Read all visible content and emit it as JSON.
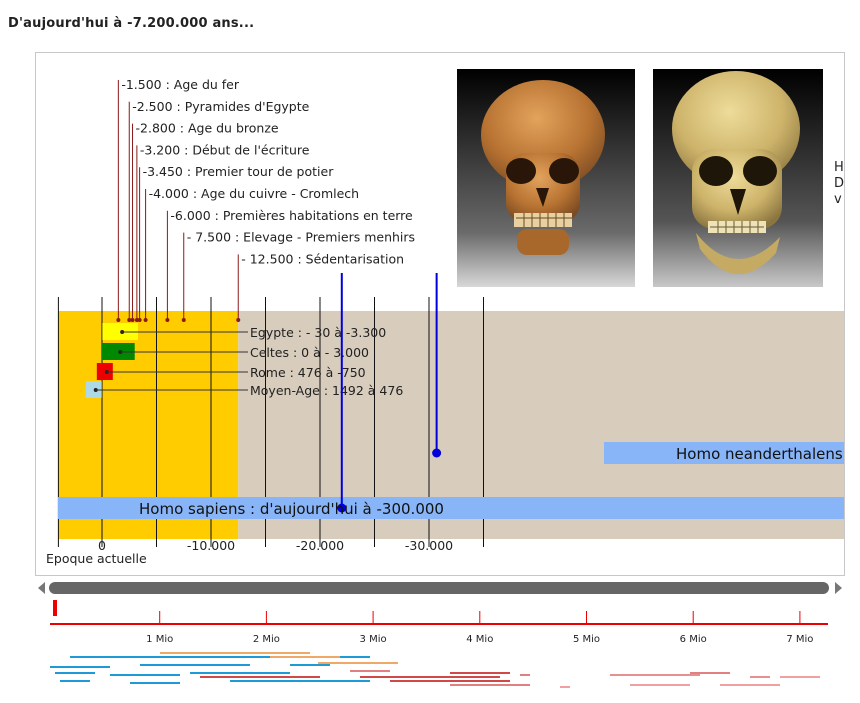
{
  "title": "D'aujourd'hui à -7.200.000 ans...",
  "colors": {
    "recent_zone": "#ffcc00",
    "ancient_zone": "#d8ccbc",
    "span_bar": "#88b4f8",
    "blue_marker": "#0000dd",
    "event_line": "#8b1a1a",
    "egypte": "#ffff00",
    "celtes": "#008800",
    "rome": "#ee0000",
    "moyen_age": "#add8e6",
    "minimap_red": "#ee0000"
  },
  "timeline": {
    "axis_ticks": [
      {
        "value": 0,
        "label": "0"
      },
      {
        "value": -10000,
        "label": "-10.000"
      },
      {
        "value": -20000,
        "label": "-20.000"
      },
      {
        "value": -30000,
        "label": "-30.000"
      }
    ],
    "current_epoch_label": "Epoque actuelle",
    "events": [
      {
        "year": -1500,
        "label": "-1.500 : Age du fer"
      },
      {
        "year": -2500,
        "label": "-2.500 : Pyramides d'Egypte"
      },
      {
        "year": -2800,
        "label": "-2.800 : Age du bronze"
      },
      {
        "year": -3200,
        "label": "-3.200 : Début de l'écriture"
      },
      {
        "year": -3450,
        "label": "-3.450 : Premier tour de potier"
      },
      {
        "year": -4000,
        "label": "-4.000 : Age du cuivre - Cromlech"
      },
      {
        "year": -6000,
        "label": "-6.000 : Premières habitations en terre"
      },
      {
        "year": -7500,
        "label": "- 7.500 : Elevage - Premiers menhirs"
      },
      {
        "year": -12500,
        "label": "- 12.500 : Sédentarisation"
      }
    ],
    "civilizations": [
      {
        "name": "egypte",
        "start": -30,
        "end": -3300,
        "label": "Egypte : - 30 à -3.300"
      },
      {
        "name": "celtes",
        "start": 0,
        "end": -3000,
        "label": "Celtes : 0 à - 3.000"
      },
      {
        "name": "rome",
        "start": 476,
        "end": -750,
        "label": "Rome : 476 à -750"
      },
      {
        "name": "moyen_age",
        "start": 1492,
        "end": 476,
        "label": "Moyen-Age : 1492 à 476"
      }
    ],
    "species": [
      {
        "name": "sapiens",
        "marker_year": -22000,
        "label": "Homo sapiens : d'aujourd'hui à -300.000"
      },
      {
        "name": "neanderthal",
        "marker_year": -30700,
        "label": "Homo neanderthalensis"
      }
    ],
    "side_text": [
      "H",
      "D",
      "v"
    ],
    "sedentary_zone_end": -12500
  },
  "minimap": {
    "ticks": [
      {
        "value": 1,
        "label": "1 Mio"
      },
      {
        "value": 2,
        "label": "2 Mio"
      },
      {
        "value": 3,
        "label": "3 Mio"
      },
      {
        "value": 4,
        "label": "4 Mio"
      },
      {
        "value": 5,
        "label": "5 Mio"
      },
      {
        "value": 6,
        "label": "6 Mio"
      },
      {
        "value": 7,
        "label": "7 Mio"
      }
    ]
  }
}
